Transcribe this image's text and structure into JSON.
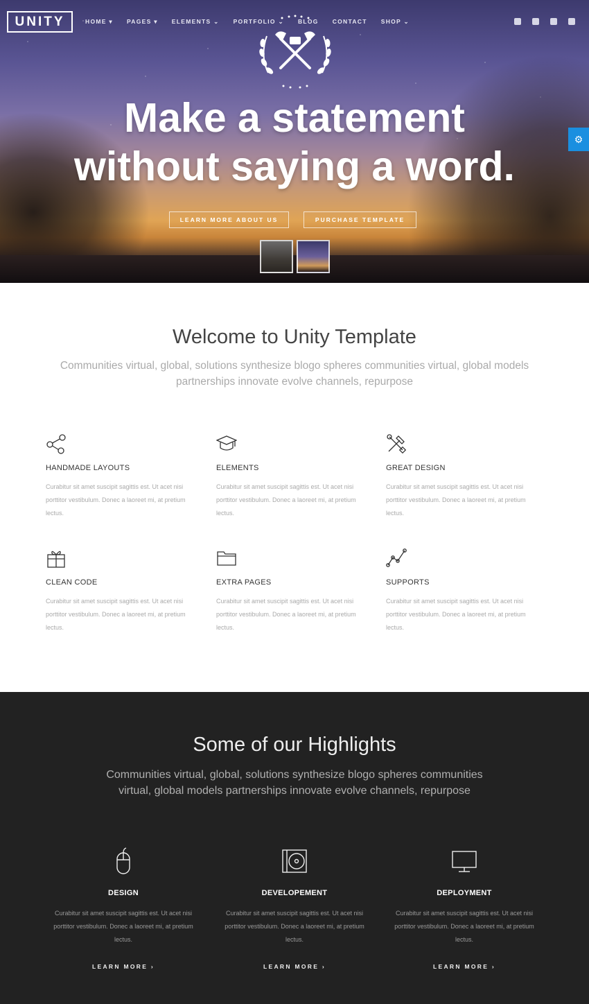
{
  "header": {
    "logo": "UNITY",
    "nav": [
      "HOME ▾",
      "PAGES ▾",
      "ELEMENTS ⌄",
      "PORTFOLIO ⌄",
      "BLOG",
      "CONTACT",
      "SHOP ⌄"
    ],
    "social": [
      "twitter-icon",
      "facebook-icon",
      "instagram-icon",
      "youtube-icon"
    ]
  },
  "hero": {
    "title_line1": "Make a statement",
    "title_line2": "without saying a word.",
    "btn_learn": "LEARN MORE ABOUT US",
    "btn_purchase": "PURCHASE TEMPLATE"
  },
  "welcome": {
    "title": "Welcome to Unity Template",
    "subtitle": "Communities virtual, global, solutions synthesize blogo spheres communities virtual, global models partnerships innovate evolve channels, repurpose"
  },
  "features": [
    {
      "icon": "share-icon",
      "title": "HANDMADE LAYOUTS",
      "text": "Curabitur sit amet suscipit sagittis est. Ut acet nisi porttitor vestibulum. Donec a laoreet mi, at pretium lectus."
    },
    {
      "icon": "graduation-cap-icon",
      "title": "ELEMENTS",
      "text": "Curabitur sit amet suscipit sagittis est. Ut acet nisi porttitor vestibulum. Donec a laoreet mi, at pretium lectus."
    },
    {
      "icon": "tools-icon",
      "title": "GREAT DESIGN",
      "text": "Curabitur sit amet suscipit sagittis est. Ut acet nisi porttitor vestibulum. Donec a laoreet mi, at pretium lectus."
    },
    {
      "icon": "gift-icon",
      "title": "CLEAN CODE",
      "text": "Curabitur sit amet suscipit sagittis est. Ut acet nisi porttitor vestibulum. Donec a laoreet mi, at pretium lectus."
    },
    {
      "icon": "folder-icon",
      "title": "EXTRA PAGES",
      "text": "Curabitur sit amet suscipit sagittis est. Ut acet nisi porttitor vestibulum. Donec a laoreet mi, at pretium lectus."
    },
    {
      "icon": "chart-line-icon",
      "title": "SUPPORTS",
      "text": "Curabitur sit amet suscipit sagittis est. Ut acet nisi porttitor vestibulum. Donec a laoreet mi, at pretium lectus."
    }
  ],
  "highlights": {
    "title": "Some of our Highlights",
    "subtitle": "Communities virtual, global, solutions synthesize blogo spheres communities virtual, global models partnerships innovate evolve channels, repurpose",
    "items": [
      {
        "icon": "mouse-icon",
        "title": "DESIGN",
        "text": "Curabitur sit amet suscipit sagittis est. Ut acet nisi porttitor vestibulum. Donec a laoreet mi, at pretium lectus.",
        "link": "LEARN MORE ›"
      },
      {
        "icon": "disc-icon",
        "title": "DEVELOPEMENT",
        "text": "Curabitur sit amet suscipit sagittis est. Ut acet nisi porttitor vestibulum. Donec a laoreet mi, at pretium lectus.",
        "link": "LEARN MORE ›"
      },
      {
        "icon": "monitor-icon",
        "title": "DEPLOYMENT",
        "text": "Curabitur sit amet suscipit sagittis est. Ut acet nisi porttitor vestibulum. Donec a laoreet mi, at pretium lectus.",
        "link": "LEARN MORE ›"
      }
    ]
  },
  "colors": {
    "accent": "#1a8fe0",
    "dark_bg": "#222222"
  }
}
